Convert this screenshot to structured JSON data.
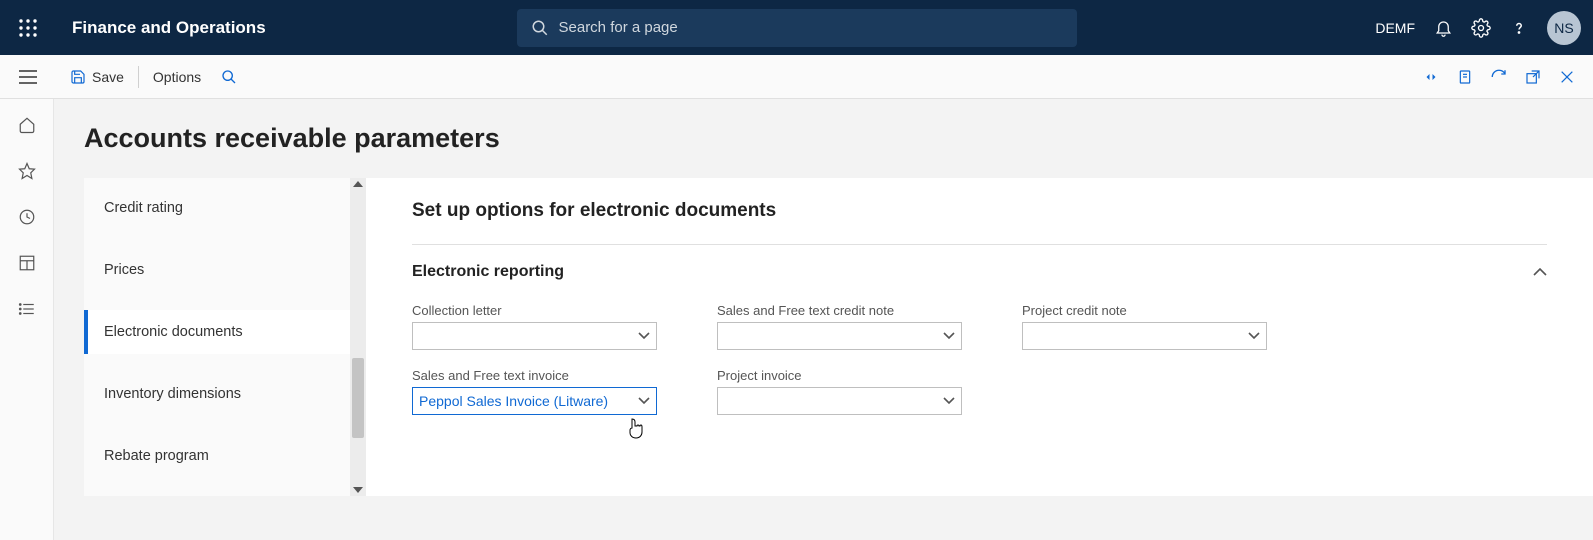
{
  "header": {
    "app_title": "Finance and Operations",
    "search_placeholder": "Search for a page",
    "company": "DEMF",
    "user_initials": "NS"
  },
  "command_bar": {
    "save": "Save",
    "options": "Options"
  },
  "page": {
    "title": "Accounts receivable parameters"
  },
  "side_nav": {
    "items": [
      {
        "label": "Credit rating",
        "active": false
      },
      {
        "label": "Prices",
        "active": false
      },
      {
        "label": "Electronic documents",
        "active": true
      },
      {
        "label": "Inventory dimensions",
        "active": false
      },
      {
        "label": "Rebate program",
        "active": false
      }
    ]
  },
  "main": {
    "title": "Set up options for electronic documents",
    "section": "Electronic reporting",
    "fields": {
      "collection_letter": {
        "label": "Collection letter",
        "value": ""
      },
      "sales_free_text_invoice": {
        "label": "Sales and Free text invoice",
        "value": "Peppol Sales Invoice (Litware)"
      },
      "sales_free_text_credit_note": {
        "label": "Sales and Free text credit note",
        "value": ""
      },
      "project_invoice": {
        "label": "Project invoice",
        "value": ""
      },
      "project_credit_note": {
        "label": "Project credit note",
        "value": ""
      }
    }
  }
}
